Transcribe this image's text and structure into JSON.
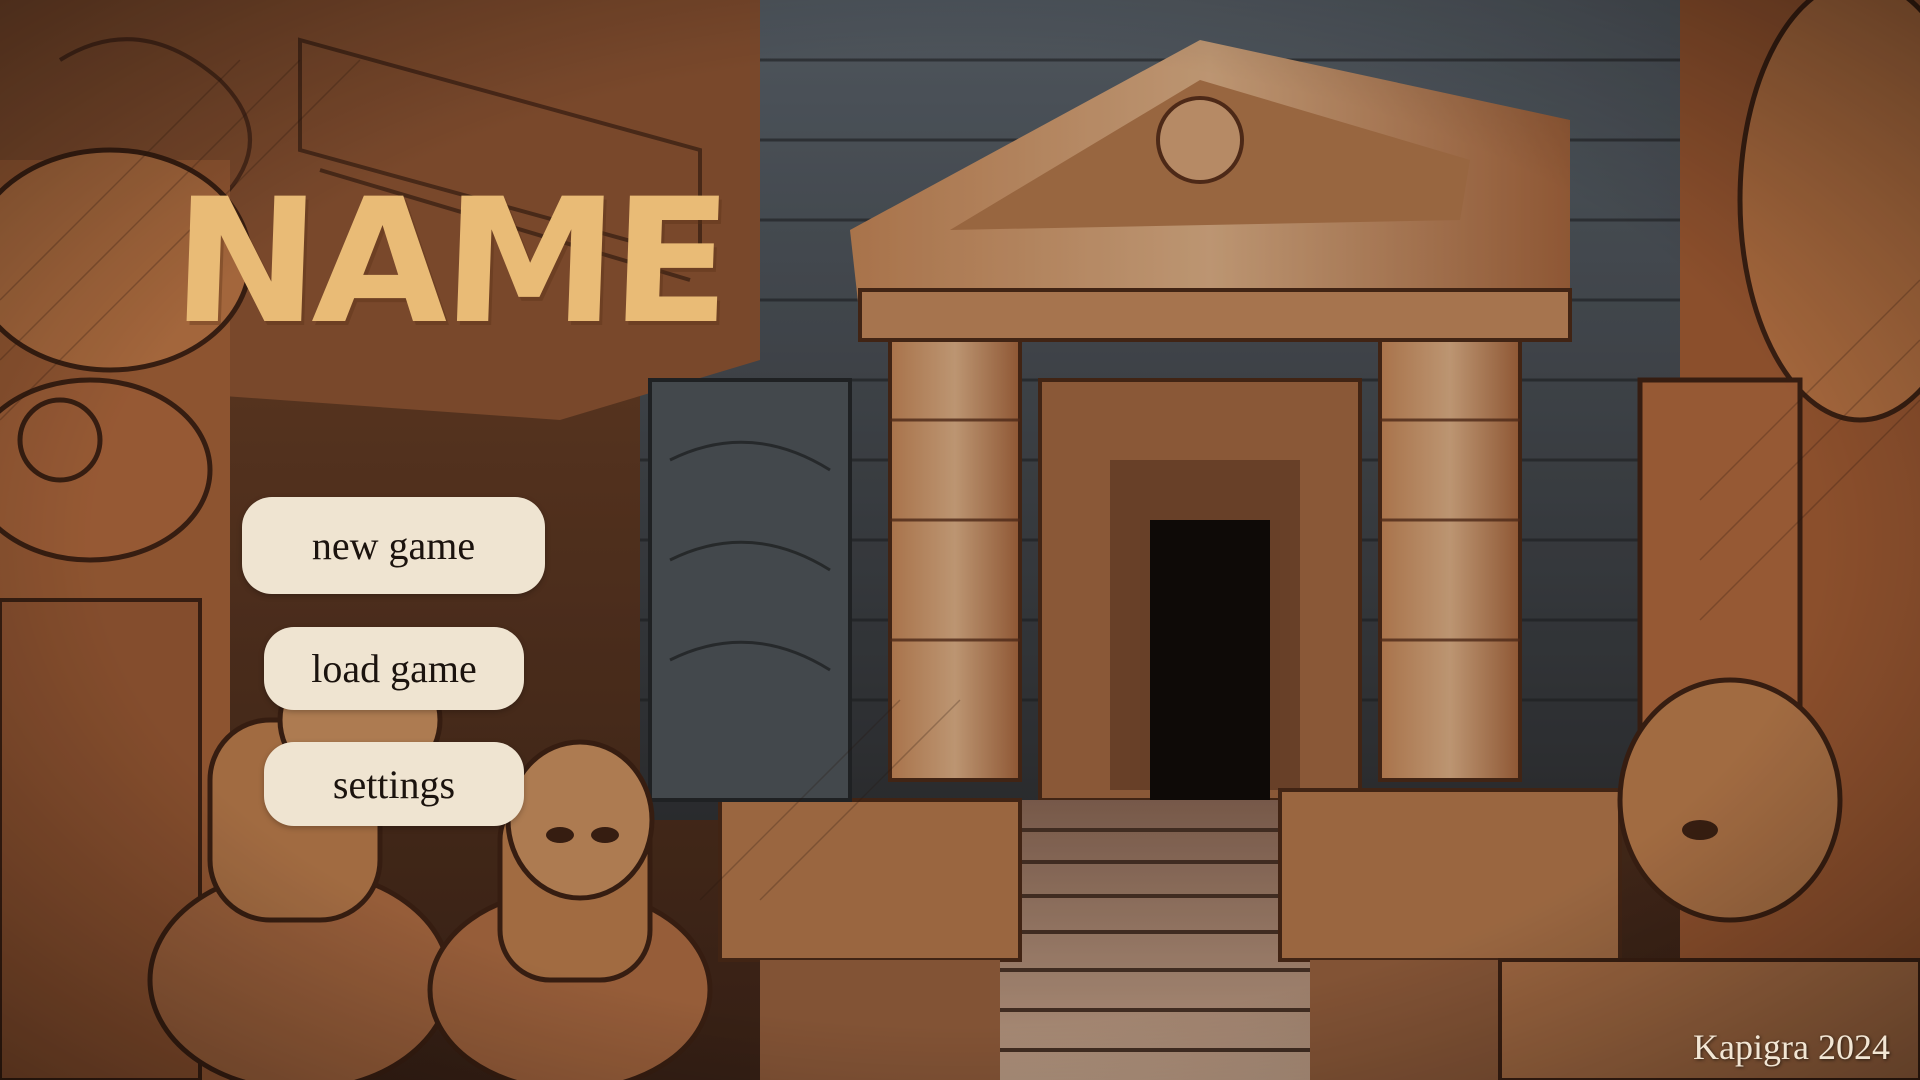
{
  "title": "NAME",
  "menu": {
    "new_game_label": "new game",
    "load_game_label": "load game",
    "settings_label": "settings"
  },
  "footer": {
    "credit": "Kapigra 2024"
  },
  "colors": {
    "title": "#e9bb76",
    "button_bg": "#efe4d1",
    "button_text": "#1b130e",
    "credit_text": "#f2e6d4"
  }
}
